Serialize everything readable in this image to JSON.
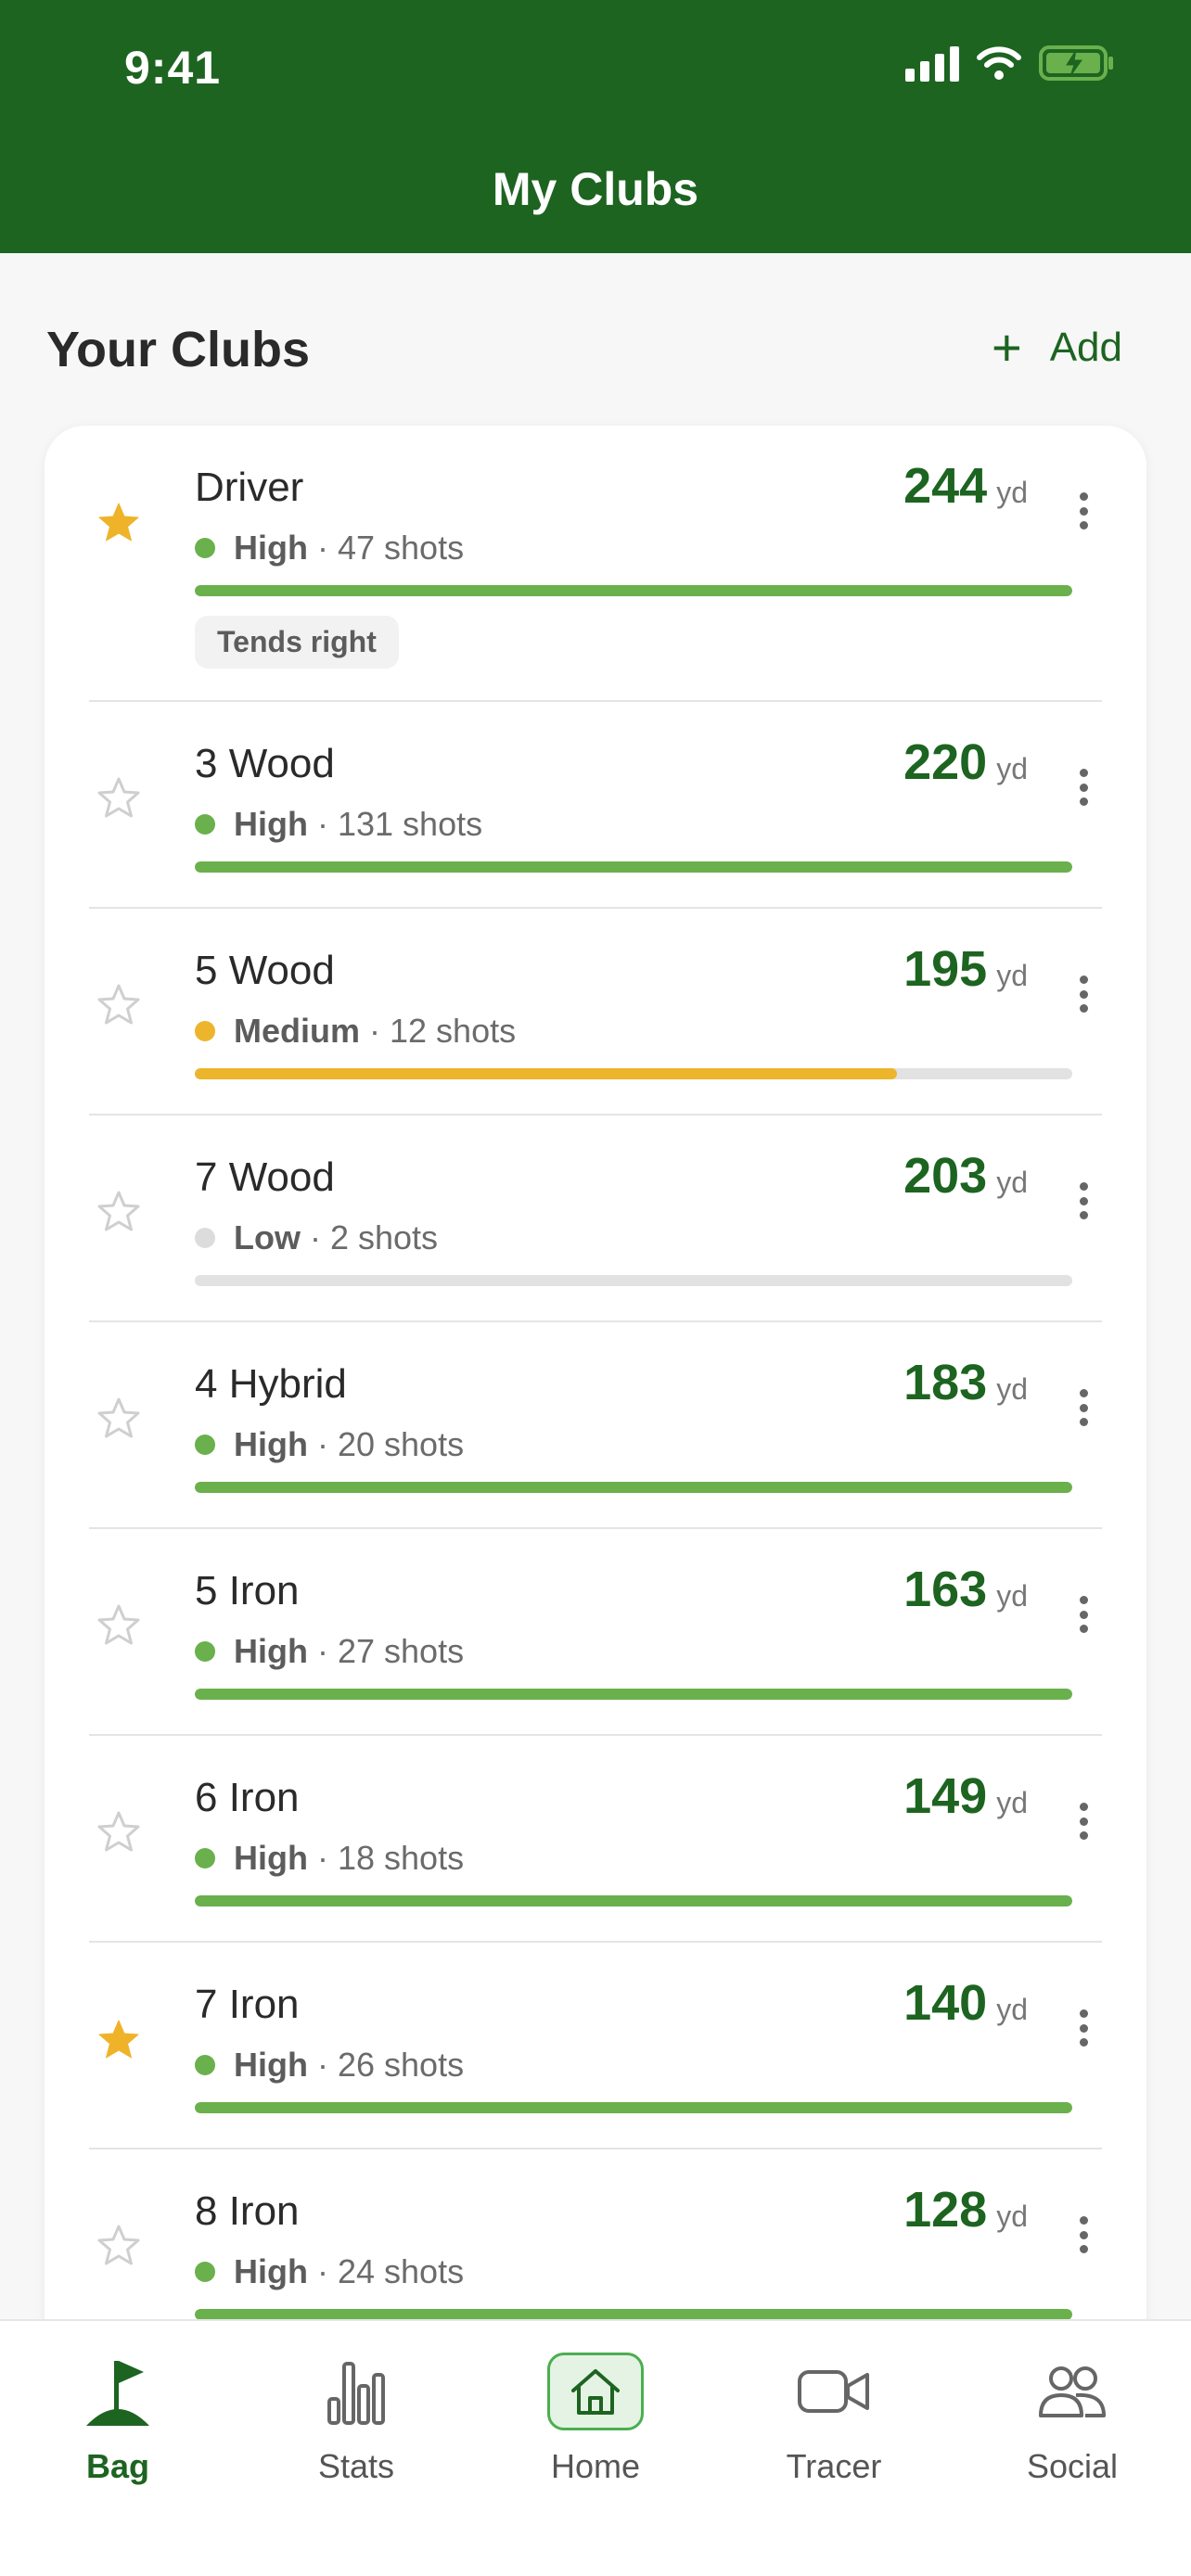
{
  "status": {
    "time": "9:41"
  },
  "header": {
    "title": "My Clubs"
  },
  "section": {
    "title": "Your Clubs",
    "add_label": "Add"
  },
  "colors": {
    "brand": "#1d6421",
    "high": "#6ab04c",
    "medium": "#ecb52c",
    "low": "#dcdcdc",
    "star": "#efb32a"
  },
  "clubs": [
    {
      "name": "Driver",
      "distance": "244",
      "unit": "yd",
      "confidence": "High",
      "shots": "· 47 shots",
      "favorite": true,
      "fill": 1.0,
      "tag": "Tends right"
    },
    {
      "name": "3 Wood",
      "distance": "220",
      "unit": "yd",
      "confidence": "High",
      "shots": "· 131 shots",
      "favorite": false,
      "fill": 1.0
    },
    {
      "name": "5 Wood",
      "distance": "195",
      "unit": "yd",
      "confidence": "Medium",
      "shots": "· 12 shots",
      "favorite": false,
      "fill": 0.8
    },
    {
      "name": "7 Wood",
      "distance": "203",
      "unit": "yd",
      "confidence": "Low",
      "shots": "· 2 shots",
      "favorite": false,
      "fill": 0.0
    },
    {
      "name": "4 Hybrid",
      "distance": "183",
      "unit": "yd",
      "confidence": "High",
      "shots": "· 20 shots",
      "favorite": false,
      "fill": 1.0
    },
    {
      "name": "5 Iron",
      "distance": "163",
      "unit": "yd",
      "confidence": "High",
      "shots": "· 27 shots",
      "favorite": false,
      "fill": 1.0
    },
    {
      "name": "6 Iron",
      "distance": "149",
      "unit": "yd",
      "confidence": "High",
      "shots": "· 18 shots",
      "favorite": false,
      "fill": 1.0
    },
    {
      "name": "7 Iron",
      "distance": "140",
      "unit": "yd",
      "confidence": "High",
      "shots": "· 26 shots",
      "favorite": true,
      "fill": 1.0
    },
    {
      "name": "8 Iron",
      "distance": "128",
      "unit": "yd",
      "confidence": "High",
      "shots": "· 24 shots",
      "favorite": false,
      "fill": 1.0
    }
  ],
  "tabs": [
    {
      "label": "Bag",
      "icon": "golf-flag-icon",
      "active": true
    },
    {
      "label": "Stats",
      "icon": "bar-chart-icon",
      "active": false
    },
    {
      "label": "Home",
      "icon": "home-icon",
      "active": false
    },
    {
      "label": "Tracer",
      "icon": "video-camera-icon",
      "active": false
    },
    {
      "label": "Social",
      "icon": "people-icon",
      "active": false
    }
  ]
}
